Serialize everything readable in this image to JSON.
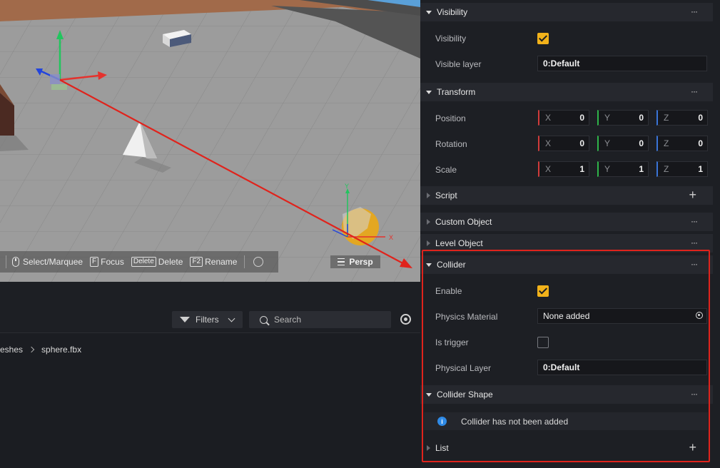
{
  "viewport": {
    "toolbar": {
      "select_label": "Select/Marquee",
      "focus_key": "F",
      "focus_label": "Focus",
      "delete_key": "Delete",
      "delete_label": "Delete",
      "rename_key": "F2",
      "rename_label": "Rename"
    },
    "camera_mode": "Persp",
    "gizmo_labels": {
      "y": "Y",
      "x": "X"
    }
  },
  "assets": {
    "filters_label": "Filters",
    "search_placeholder": "Search",
    "breadcrumb": [
      "eshes",
      "sphere.fbx"
    ]
  },
  "inspector": {
    "visibility": {
      "title": "Visibility",
      "visibility_label": "Visibility",
      "visibility_checked": true,
      "layer_label": "Visible layer",
      "layer_value": "0:Default"
    },
    "transform": {
      "title": "Transform",
      "rows": [
        {
          "label": "Position",
          "x": "0",
          "y": "0",
          "z": "0"
        },
        {
          "label": "Rotation",
          "x": "0",
          "y": "0",
          "z": "0"
        },
        {
          "label": "Scale",
          "x": "1",
          "y": "1",
          "z": "1"
        }
      ],
      "axis_labels": {
        "x": "X",
        "y": "Y",
        "z": "Z"
      }
    },
    "script": {
      "title": "Script"
    },
    "custom_object": {
      "title": "Custom Object"
    },
    "level_object": {
      "title": "Level Object"
    },
    "collider": {
      "title": "Collider",
      "enable_label": "Enable",
      "enable_checked": true,
      "physics_material_label": "Physics Material",
      "physics_material_value": "None added",
      "is_trigger_label": "Is trigger",
      "is_trigger_checked": false,
      "physical_layer_label": "Physical Layer",
      "physical_layer_value": "0:Default"
    },
    "collider_shape": {
      "title": "Collider Shape",
      "info_text": "Collider has not been added"
    },
    "list": {
      "title": "List"
    },
    "more_label": "···"
  },
  "colors": {
    "accent_checkbox": "#f2b21a",
    "highlight": "#e0231c",
    "axis_x": "#d23b3b",
    "axis_y": "#2fb44a",
    "axis_z": "#3a74d8",
    "info": "#2f8ae6"
  }
}
